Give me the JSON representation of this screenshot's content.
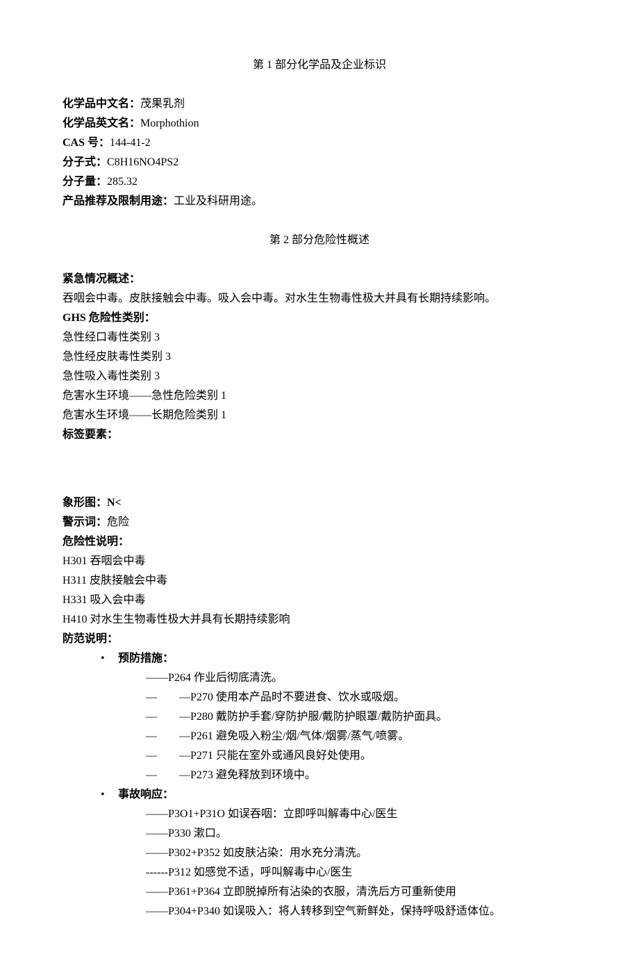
{
  "section1": {
    "title": "第 1 部分化学品及企业标识",
    "cnName": {
      "label": "化学品中文名：",
      "value": "茂果乳剂"
    },
    "enName": {
      "label": "化学品英文名：",
      "value": "Morphothion"
    },
    "cas": {
      "label": "CAS 号：",
      "value": "144-41-2"
    },
    "formula": {
      "label": "分子式：",
      "value": "C8H16NO4PS2"
    },
    "mw": {
      "label": "分子量：",
      "value": "285.32"
    },
    "use": {
      "label": "产品推荐及限制用途：",
      "value": "工业及科研用途。"
    }
  },
  "section2": {
    "title": "第 2 部分危险性概述",
    "emergency": {
      "label": "紧急情况概述：",
      "text": "吞咽会中毒。皮肤接触会中毒。吸入会中毒。对水生生物毒性极大并具有长期持续影响。"
    },
    "ghsLabel": "GHS 危险性类别：",
    "ghs": [
      "急性经口毒性类别 3",
      "急性经皮肤毒性类别 3",
      "急性吸入毒性类别 3",
      "危害水生环境——急性危险类别 1",
      "危害水生环境——长期危险类别 1"
    ],
    "tagLabel": "标签要素：",
    "pictogram": "象形图：N<",
    "signal": {
      "label": "警示词：",
      "value": "危险"
    },
    "hazardLabel": "危险性说明：",
    "hazards": [
      "H301 吞咽会中毒",
      "H311 皮肤接触会中毒",
      "H331 吸入会中毒",
      "H410 对水生生物毒性极大并具有长期持续影响"
    ],
    "precautionLabel": "防范说明：",
    "precaution": {
      "preventLabel": "预防措施：",
      "prevent": [
        "——P264 作业后彻底清洗。",
        "—　　—P270 使用本产品时不要进食、饮水或吸烟。",
        "—　　—P280 戴防护手套/穿防护服/戴防护眼罩/戴防护面具。",
        "—　　—P261 避免吸入粉尘/烟/气体/烟雾/蒸气/喷雾。",
        "—　　—P271 只能在室外或通风良好处使用。",
        "—　　—P273 避免释放到环境中。"
      ],
      "responseLabel": "事故响应：",
      "response": [
        "——P3O1+P31O 如误吞咽：立即呼叫解毒中心/医生",
        "——P330 漱口。",
        "——P302+P352 如皮肤沾染：用水充分清洗。",
        "------P312 如感觉不适，呼叫解毒中心/医生",
        "——P361+P364 立即脱掉所有沾染的衣服，清洗后方可重新使用",
        "——P304+P340 如误吸入：将人转移到空气新鲜处，保持呼吸舒适体位。"
      ]
    }
  }
}
